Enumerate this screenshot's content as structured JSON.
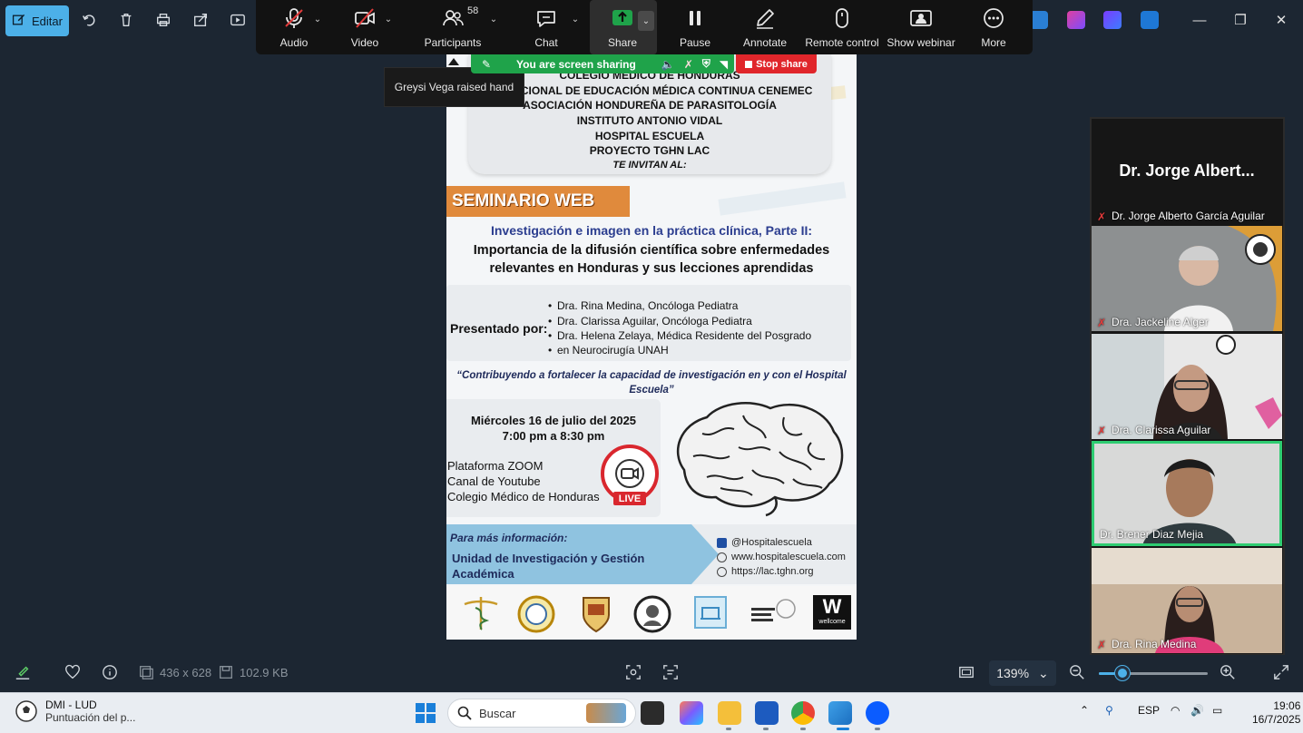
{
  "photos_toolbar": {
    "edit_label": "Editar"
  },
  "zoom_bar": {
    "audio_label": "Audio",
    "video_label": "Video",
    "participants_label": "Participants",
    "participants_count": "58",
    "chat_label": "Chat",
    "share_label": "Share",
    "pause_label": "Pause",
    "annotate_label": "Annotate",
    "remote_control_label": "Remote control",
    "show_webinar_label": "Show webinar",
    "more_label": "More"
  },
  "tooltip": {
    "text": "Greysi Vega raised hand"
  },
  "sharing_banner": {
    "text": "You are screen sharing",
    "stop_label": "Stop share"
  },
  "poster": {
    "org_lines": [
      "COLEGIO MÉDICO DE HONDURAS",
      "NACIONAL DE EDUCACIÓN MÉDICA CONTINUA CENEMEC",
      "ASOCIACIÓN HONDUREÑA DE PARASITOLOGÍA",
      "INSTITUTO ANTONIO VIDAL",
      "HOSPITAL ESCUELA",
      "PROYECTO TGHN LAC"
    ],
    "invite": "TE INVITAN AL:",
    "seminar_tag": "SEMINARIO WEB",
    "title_line1": "Investigación e imagen en la práctica clínica, Parte II:",
    "title_line2": "Importancia de la difusión científica sobre enfermedades relevantes en Honduras y sus lecciones aprendidas",
    "presented_by": "Presentado por:",
    "presenters": [
      "Dra. Rina Medina, Oncóloga Pediatra",
      "Dra. Clarissa Aguilar, Oncóloga Pediatra",
      "Dra. Helena Zelaya, Médica Residente del Posgrado",
      "en Neurocirugía UNAH"
    ],
    "quote": "“Contribuyendo a fortalecer la capacidad de investigación en y con el Hospital Escuela”",
    "date": "Miércoles 16 de julio del 2025",
    "time": "7:00 pm a 8:30 pm",
    "platforms": [
      "Plataforma ZOOM",
      "Canal de Youtube",
      "Colegio Médico de Honduras"
    ],
    "live_label": "LIVE",
    "info_label": "Para más información:",
    "unit_name": "Unidad  de Investigación y Gestión Académica",
    "contacts": [
      "@Hospitalescuela",
      "www.hospitalescuela.com",
      "https://lac.tghn.org"
    ],
    "logo_w": "W",
    "logo_w_sub": "wellcome"
  },
  "participants": {
    "big_name": "Dr. Jorge Albert...",
    "tiles": [
      "Dr. Jorge Alberto García Aguilar",
      "Dra. Jackeline Alger",
      "Dra. Clarissa Aguilar",
      "Dr. Brener Diaz Mejia",
      "Dra. Rina Medina"
    ]
  },
  "bottom_bar": {
    "dimensions": "436 x 628",
    "file_size": "102.9 KB",
    "zoom_level": "139%",
    "zoom_fraction": 0.22
  },
  "taskbar": {
    "weather_title": "DMI - LUD",
    "weather_sub": "Puntuación del p...",
    "search_placeholder": "Buscar",
    "language": "ESP",
    "time": "19:06",
    "date": "16/7/2025"
  },
  "colors": {
    "accent": "#4cb0e8",
    "share_green": "#1fa34a",
    "stop_red": "#e0262b",
    "active_speaker": "#2ecc71"
  }
}
